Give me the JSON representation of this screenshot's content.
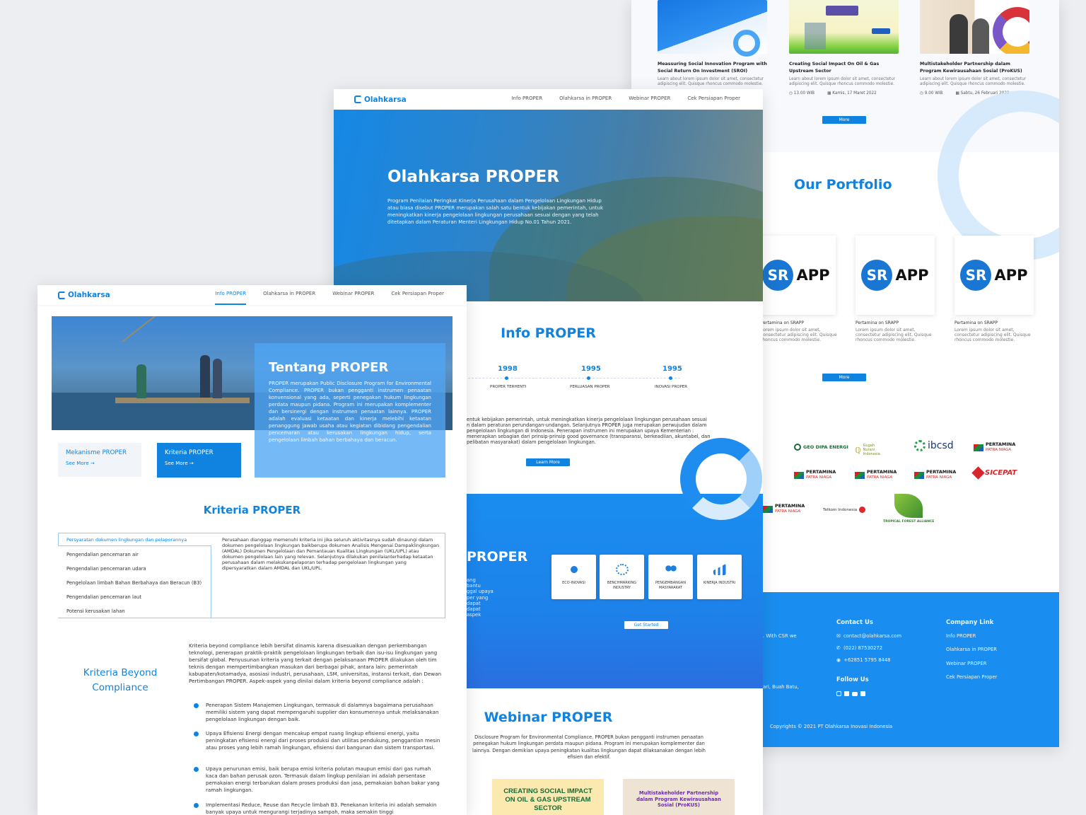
{
  "colors": {
    "accent": "#1083e0",
    "footer": "#1a8ef0",
    "background": "#eceef1"
  },
  "brand": "Olahkarsa",
  "nav": [
    "Info PROPER",
    "Olahkarsa in PROPER",
    "Webinar PROPER",
    "Cek Persiapan Proper"
  ],
  "right_page": {
    "webinars": [
      {
        "title": "Meassuring Social Innovation Program with Social Return On Investment (SROI)",
        "desc": "Learn about lorem ipsum dolor sit amet, consectetur adipiscing elit. Quisque rhoncus commodo molestie.",
        "time": "",
        "date": ""
      },
      {
        "title": "Creating Social Impact On Oil & Gas Upstream Sector",
        "desc": "Learn about lorem ipsum dolor sit amet, consectetur adipiscing elit. Quisque rhoncus commodo molestie.",
        "time": "13.00 WIB",
        "date": "Kamis, 17 Maret 2022"
      },
      {
        "title": "Multistakeholder Partnership dalam Program Kewirausahaan Sosial (ProKUS)",
        "desc": "Learn about lorem ipsum dolor sit amet, consectetur adipiscing elit. Quisque rhoncus commodo molestie.",
        "time": "9.00 WIB",
        "date": "Sabtu, 26 Februari 2022"
      }
    ],
    "more": "More",
    "portfolio_title": "Our Portfolio",
    "app_sr": "SR",
    "app_word": "APP",
    "app_caption": "Pertamina on SRAPP",
    "app_desc": "Lorem ipsum dolor sit amet, consectetur adipiscing elit. Quisque rhoncus commodo molestie.",
    "partners": {
      "geo": "GEO DIPA ENERGI",
      "gugah": "Gugah Nurani Indonesia",
      "ibcsd": "ibcsd",
      "pertamina": "PERTAMINA",
      "patra": "PATRA NIAGA",
      "sicepat": "SICEPAT",
      "telkom": "Telkom Indonesia",
      "tfa": "TROPICAL FOREST ALLIANCE"
    },
    "footer": {
      "contact_title": "Contact Us",
      "email": "contact@olahkarsa.com",
      "phone": "(022) 87530272",
      "wa": "+62851 5795 8448",
      "follow": "Follow Us",
      "company_title": "Company Link",
      "links": [
        "Info PROPER",
        "Olahkarsa in PROPER",
        "Webinar PROPER",
        "Cek Persiapan Proper"
      ],
      "partial1": ". With CSR we",
      "partial2": "ari, Buah Batu,",
      "copyright": "Copyrights © 2021  PT Olahkarsa Inovasi Indonesia"
    }
  },
  "middle_page": {
    "hero_title": "Olahkarsa PROPER",
    "hero_text": "Program Penilaian Peringkat Kinerja Perusahaan dalam Pengelolaan Lingkungan Hidup atau biasa disebut PROPER merupakan salah satu bentuk kebijakan pemerintah, untuk meningkatkan kinerja pengelolaan lingkungan perusahaan sesuai dengan yang telah ditetapkan dalam Peraturan Menteri Lingkungan Hidup No.01 Tahun 2021.",
    "info_title": "Info PROPER",
    "timeline": [
      {
        "year": "1998",
        "label": "PROPER TERHENTI"
      },
      {
        "year": "1995",
        "label": "PERLUASAN PROPER"
      },
      {
        "year": "1995",
        "label": "INOVASI PROPER"
      }
    ],
    "info_text": "entuk kebijakan pemerintah, untuk meningkatkan kinerja pengelolaan lingkungan perusahaan sesuai n dalam peraturan perundangan-undangan. Selanjutnya PROPER juga merupakan perwujudan dalam pengelolaan lingkungan di Indonesia. Penerapan instrumen ini merupakan upaya Kementerian : menerapkan sebagian dari prinsip-prinsip good governance (transparansi, berkeadilan, akuntabel, dan pelibatan masyarakat) dalam pengelolaan lingkungan.",
    "learn_more": "Learn More",
    "blue_title": "PROPER",
    "blue_frag": [
      "ang",
      "bantu",
      "ggal upaya",
      "per yang",
      "dapat",
      "dapat",
      "aspek"
    ],
    "pillars": [
      "ECO-INOVASI",
      "BENCHMARKING INDUSTRY",
      "PENGEMBANGAN MASYARAKAT",
      "KINERJA INDUSTRI"
    ],
    "get_started": "Get Started",
    "webinar_title": "Webinar PROPER",
    "webinar_text": "Disclosure Program for Environmental Compliance. PROPER bukan pengganti instrumen penaatan penegakan hukum lingkungan perdata maupun pidana. Program ini merupakan komplementer dan lainnya. Dengan demikian upaya peningkatan kualitas lingkungan dapat dilaksanakan dengan lebih efisien dan efektif.",
    "thumb1": "CREATING SOCIAL IMPACT ON OIL & GAS UPSTREAM SECTOR",
    "thumb2": "Multistakeholder Partnership dalam Program Kewirausahaan Sosial (ProKUS)"
  },
  "left_page": {
    "tentang_title": "Tentang PROPER",
    "tentang_text": "PROPER merupakan Public Disclosure Program for Environmental Compliance. PROPER bukan pengganti instrumen penaatan konvensional yang ada, seperti penegakan hukum lingkungan perdata maupun pidana. Program ini merupakan komplementer dan bersinergi dengan instrumen penaatan lainnya. PROPER adalah evaluasi ketaatan dan kinerja melebihi ketaatan penanggung jawab usaha atau kegiatan dibidang pengendalian pencemaran atau kerusakan lingkungan hidup, serta pengelolaan limbah bahan berbahaya dan beracun.",
    "card1": "Mekanisme PROPER",
    "card2": "Kriteria PROPER",
    "see_more": "See More",
    "kriteria_title": "Kriteria PROPER",
    "criteria": [
      "Persyaratan dokumen lingkungan dan pelaporannya",
      "Pengendalian pencemaran air",
      "Pengendalian pencemaran udara",
      "Pengelolaan limbah Bahan Berbahaya dan Beracun (B3)",
      "Pengendalian pencemaran laut",
      "Potensi kerusakan lahan"
    ],
    "criteria_detail": "Perusahaan dianggap memenuhi kriteria ini jika seluruh aktivitasnya sudah dinaungi dalam dokumen pengelolaan lingkungan baikberupa dokumen Analisis Mengenai Dampaklingkungan (AMDAL) Dokumen Pengelolaan dan Pemantauan Kualitas Lingkungan (UKL/UPL) atau dokumen pengelolaan lain yang relevan. Selanjutnya dilakukan penilaianterhadap ketaatan perusahaan dalam melakukanpelaporan terhadap pengelolaan lingkungan yang dipersyaratkan dalam AMDAL dan UKL/UPL.",
    "beyond_title_1": "Kriteria Beyond",
    "beyond_title_2": "Compliance",
    "beyond_intro": "Kriteria beyond compliance lebih bersifat dinamis karena disesuaikan dengan perkembangan teknologi, penerapan praktik-praktik pengelolaan lingkungan terbaik dan isu-isu lingkungan yang bersifat global. Penyusunan kriteria yang terkait dengan pelaksanaan PROPER dilakukan oleh tim teknis dengan mempertimbangkan masukan dari berbagai pihak, antara lain: pemerintah kabupaten/kotamadya, asosiasi industri, perusahaan, LSM, universitas, instansi terkait, dan Dewan Pertimbangan PROPER. Aspek-aspek yang dinilai dalam kriteria beyond compliance adalah :",
    "bullets": [
      "Penerapan Sistem Manajemen Lingkungan, termasuk di dalamnya bagaimana perusahaan memiliki sistem yang dapat mempengaruhi supplier dan konsumennya untuk melaksanakan pengelolaan lingkungan dengan baik.",
      "Upaya Efisiensi Energi dengan mencakup empat ruang lingkup efisiensi energi, yaitu peningkatan efisiensi energi dari proses produksi dan utilitas pendukung, penggantian mesin atau proses yang lebih ramah lingkungan, efisiensi dari bangunan dan sistem transportasi.",
      "Upaya penurunan emisi, baik berupa emisi kriteria polutan maupun emisi dari gas rumah kaca dan bahan perusak ozon. Termasuk dalam lingkup penilaian ini adalah persentase pemakaian energi terbarukan dalam proses produksi dan jasa, pemakaian bahan bakar yang ramah lingkungan.",
      "Implementasi Reduce, Reuse dan Recycle limbah B3. Penekanan kriteria ini adalah semakin banyak upaya untuk mengurangi terjadinya sampah, maka semakin tinggi"
    ]
  }
}
